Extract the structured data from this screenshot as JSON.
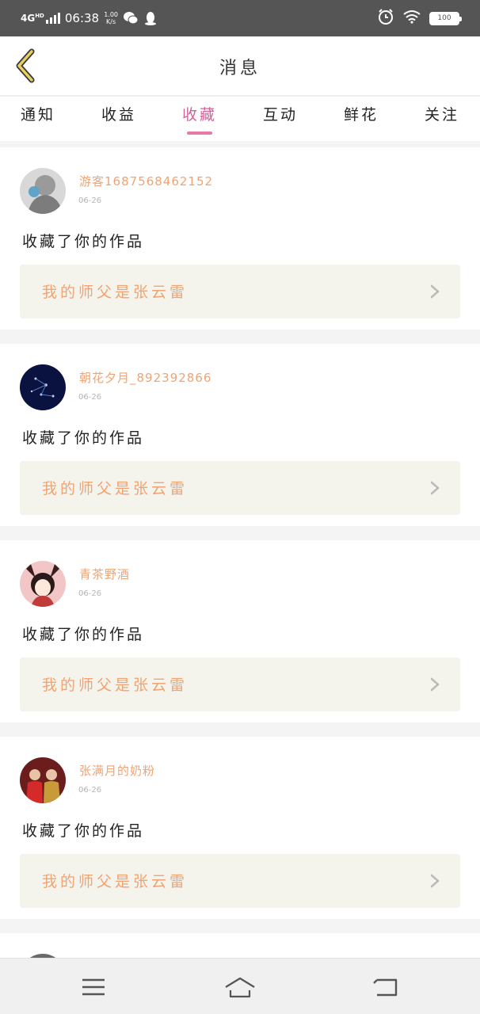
{
  "status_bar": {
    "network": "4G",
    "network_sup": "HD",
    "time": "06:38",
    "speed_top": "1.00",
    "speed_bottom": "K/s",
    "battery": "100"
  },
  "header": {
    "title": "消息"
  },
  "tabs": [
    {
      "label": "通知"
    },
    {
      "label": "收益"
    },
    {
      "label": "收藏"
    },
    {
      "label": "互动"
    },
    {
      "label": "鲜花"
    },
    {
      "label": "关注"
    }
  ],
  "active_tab": "收藏",
  "messages": [
    {
      "username": "游客1687568462152",
      "date": "06-26",
      "action": "收藏了你的作品",
      "work_title": "我的师父是张云雷"
    },
    {
      "username": "朝花夕月_892392866",
      "date": "06-26",
      "action": "收藏了你的作品",
      "work_title": "我的师父是张云雷"
    },
    {
      "username": "青茶野酒",
      "date": "06-26",
      "action": "收藏了你的作品",
      "work_title": "我的师父是张云雷"
    },
    {
      "username": "张满月的奶粉",
      "date": "06-26",
      "action": "收藏了你的作品",
      "work_title": "我的师父是张云雷"
    }
  ],
  "colors": {
    "accent_pink": "#d0619a",
    "username_orange": "#f0a373",
    "status_bar": "#555555"
  },
  "icons": {
    "back": "back-chevron-icon",
    "menu": "menu-icon",
    "home": "home-icon",
    "return": "return-icon"
  }
}
